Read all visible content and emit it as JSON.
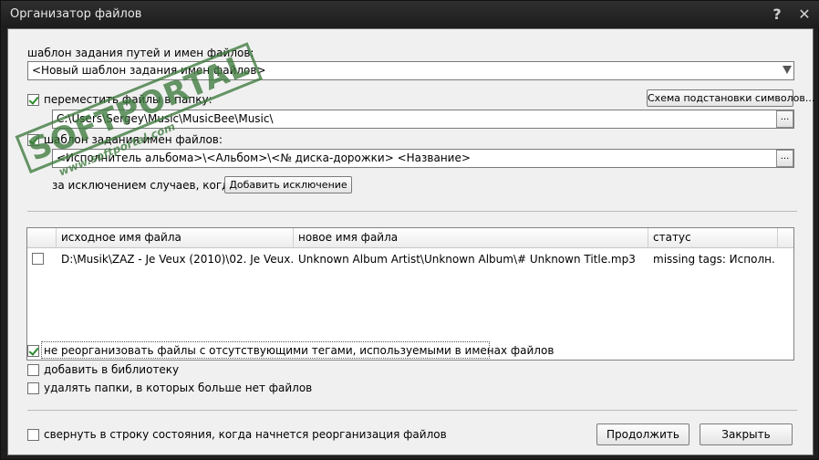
{
  "window": {
    "title": "Организатор файлов",
    "help_glyph": "?",
    "close_glyph": "✕"
  },
  "template_section": {
    "label": "шаблон задания путей и имен файлов:",
    "combo_value": "<Новый шаблон задания имен файлов>"
  },
  "move_section": {
    "checkbox_label": "переместить файлы в папку:",
    "checked": true,
    "symbol_scheme_button": "Схема подстановки символов...",
    "folder_value": "C:\\Users\\Sergey\\Music\\MusicBee\\Music\\",
    "browse_label": "..."
  },
  "name_template_section": {
    "checkbox_label": "шаблон задания имен файлов:",
    "checked": true,
    "template_value": "<Исполнитель альбома>\\<Альбом>\\<№ диска-дорожки> <Название>",
    "browse_label": "..."
  },
  "exceptions": {
    "label": "за исключением случаев, когда:",
    "add_button": "Добавить исключение"
  },
  "table": {
    "columns": [
      "исходное имя файла",
      "новое имя файла",
      "статус"
    ],
    "rows": [
      {
        "checked": false,
        "source": "D:\\Musik\\ZAZ - Je Veux (2010)\\02. Je Veux.mp3",
        "target": "Unknown Album Artist\\Unknown Album\\# Unknown Title.mp3",
        "status": "missing tags: Исполн..."
      }
    ]
  },
  "options": [
    {
      "label": "не реорганизовать файлы с отсутствующими тегами, используемыми в именах файлов",
      "checked": true
    },
    {
      "label": "добавить в библиотеку",
      "checked": false
    },
    {
      "label": "удалять папки, в которых больше нет файлов",
      "checked": false
    }
  ],
  "footer": {
    "collapse_label": "свернуть в строку состояния, когда начнется реорганизация файлов",
    "collapse_checked": false,
    "continue_button": "Продолжить",
    "close_button": "Закрыть"
  },
  "watermark": {
    "main": "SOFTPORTAL",
    "sub": "www.softportal.com"
  }
}
